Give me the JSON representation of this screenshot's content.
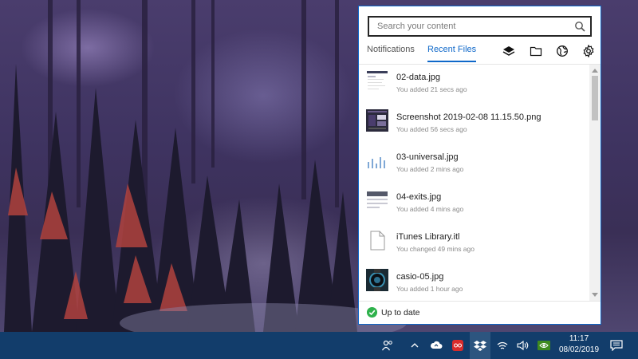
{
  "search": {
    "placeholder": "Search your content",
    "value": ""
  },
  "tabs": [
    {
      "label": "Notifications",
      "active": false
    },
    {
      "label": "Recent Files",
      "active": true
    }
  ],
  "toolbar_icons": [
    "layers-icon",
    "folder-icon",
    "globe-icon",
    "gear-icon"
  ],
  "recent_files": [
    {
      "name": "02-data.jpg",
      "meta": "You added 21 secs ago",
      "thumb": "data-chart"
    },
    {
      "name": "Screenshot 2019-02-08 11.15.50.png",
      "meta": "You added 56 secs ago",
      "thumb": "screenshot"
    },
    {
      "name": "03-universal.jpg",
      "meta": "You added 2 mins ago",
      "thumb": "bars"
    },
    {
      "name": "04-exits.jpg",
      "meta": "You added 4 mins ago",
      "thumb": "exits"
    },
    {
      "name": "iTunes Library.itl",
      "meta": "You changed 49 mins ago",
      "thumb": "document"
    },
    {
      "name": "casio-05.jpg",
      "meta": "You added 1 hour ago",
      "thumb": "watch"
    }
  ],
  "status": {
    "text": "Up to date",
    "color": "#2fb24c"
  },
  "taskbar": {
    "icons": [
      "people-icon",
      "chevron-up-icon",
      "cloud-upload-icon",
      "og-icon",
      "dropbox-icon",
      "wifi-icon",
      "volume-icon",
      "nvidia-icon",
      "notification-icon"
    ],
    "time": "11:17",
    "date": "08/02/2019"
  },
  "colors": {
    "accent": "#0f68c9",
    "taskbar": "#123d6b",
    "highlight": "#2d557f"
  }
}
